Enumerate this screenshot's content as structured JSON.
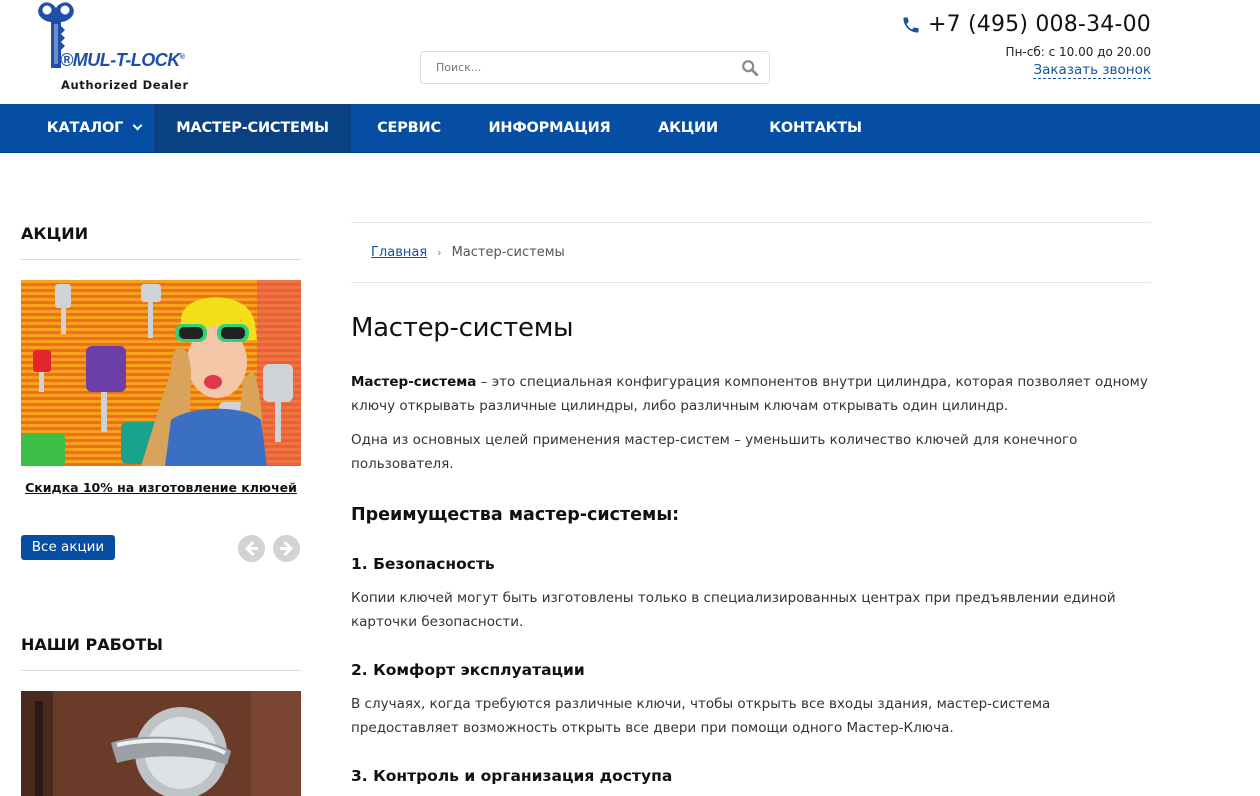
{
  "brand": {
    "name": "MUL-T-LOCK",
    "trademark": "®",
    "subtitle": "Authorized Dealer",
    "color": "#1f4fa8"
  },
  "search": {
    "placeholder": "Поиск..."
  },
  "contact": {
    "phone": "+7 (495) 008-34-00",
    "hours": "Пн-сб: с 10.00 до 20.00",
    "callback": "Заказать звонок"
  },
  "nav": {
    "items": [
      {
        "label": "КАТАЛОГ",
        "has_dropdown": true
      },
      {
        "label": "МАСТЕР-СИСТЕМЫ",
        "active": true
      },
      {
        "label": "СЕРВИС"
      },
      {
        "label": "ИНФОРМАЦИЯ"
      },
      {
        "label": "АКЦИИ"
      },
      {
        "label": "КОНТАКТЫ"
      }
    ],
    "background": "#064ea3",
    "active_background": "#0a4183"
  },
  "sidebar": {
    "promos": {
      "title": "АКЦИИ",
      "caption": "Скидка 10% на изготовление ключей",
      "all_button": "Все акции"
    },
    "works": {
      "title": "НАШИ РАБОТЫ"
    }
  },
  "breadcrumb": {
    "home": "Главная",
    "separator": "›",
    "current": "Мастер-системы"
  },
  "article": {
    "title": "Мастер-системы",
    "intro_term": "Мастер-система",
    "intro_text": " – это  специальная конфигурация компонентов внутри цилиндра, которая позволяет одному ключу открывать различные цилиндры, либо различным ключам открывать один цилиндр.",
    "goal": "Одна из основных целей применения мастер-систем – уменьшить количество ключей для конечного пользователя.",
    "advantages_title": "Преимущества мастер-системы:",
    "advantages": [
      {
        "title": "1. Безопасность",
        "text": "Копии ключей могут быть изготовлены только в специализированных центрах при предъявлении единой карточки безопасности."
      },
      {
        "title": "2. Комфорт эксплуатации",
        "text": "В случаях, когда требуются различные ключи, чтобы открыть все входы здания, мастер-система предоставляет возможность открыть все двери при помощи одного Мастер-Ключа."
      },
      {
        "title": "3. Контроль и организация доступа",
        "text": ""
      }
    ]
  }
}
